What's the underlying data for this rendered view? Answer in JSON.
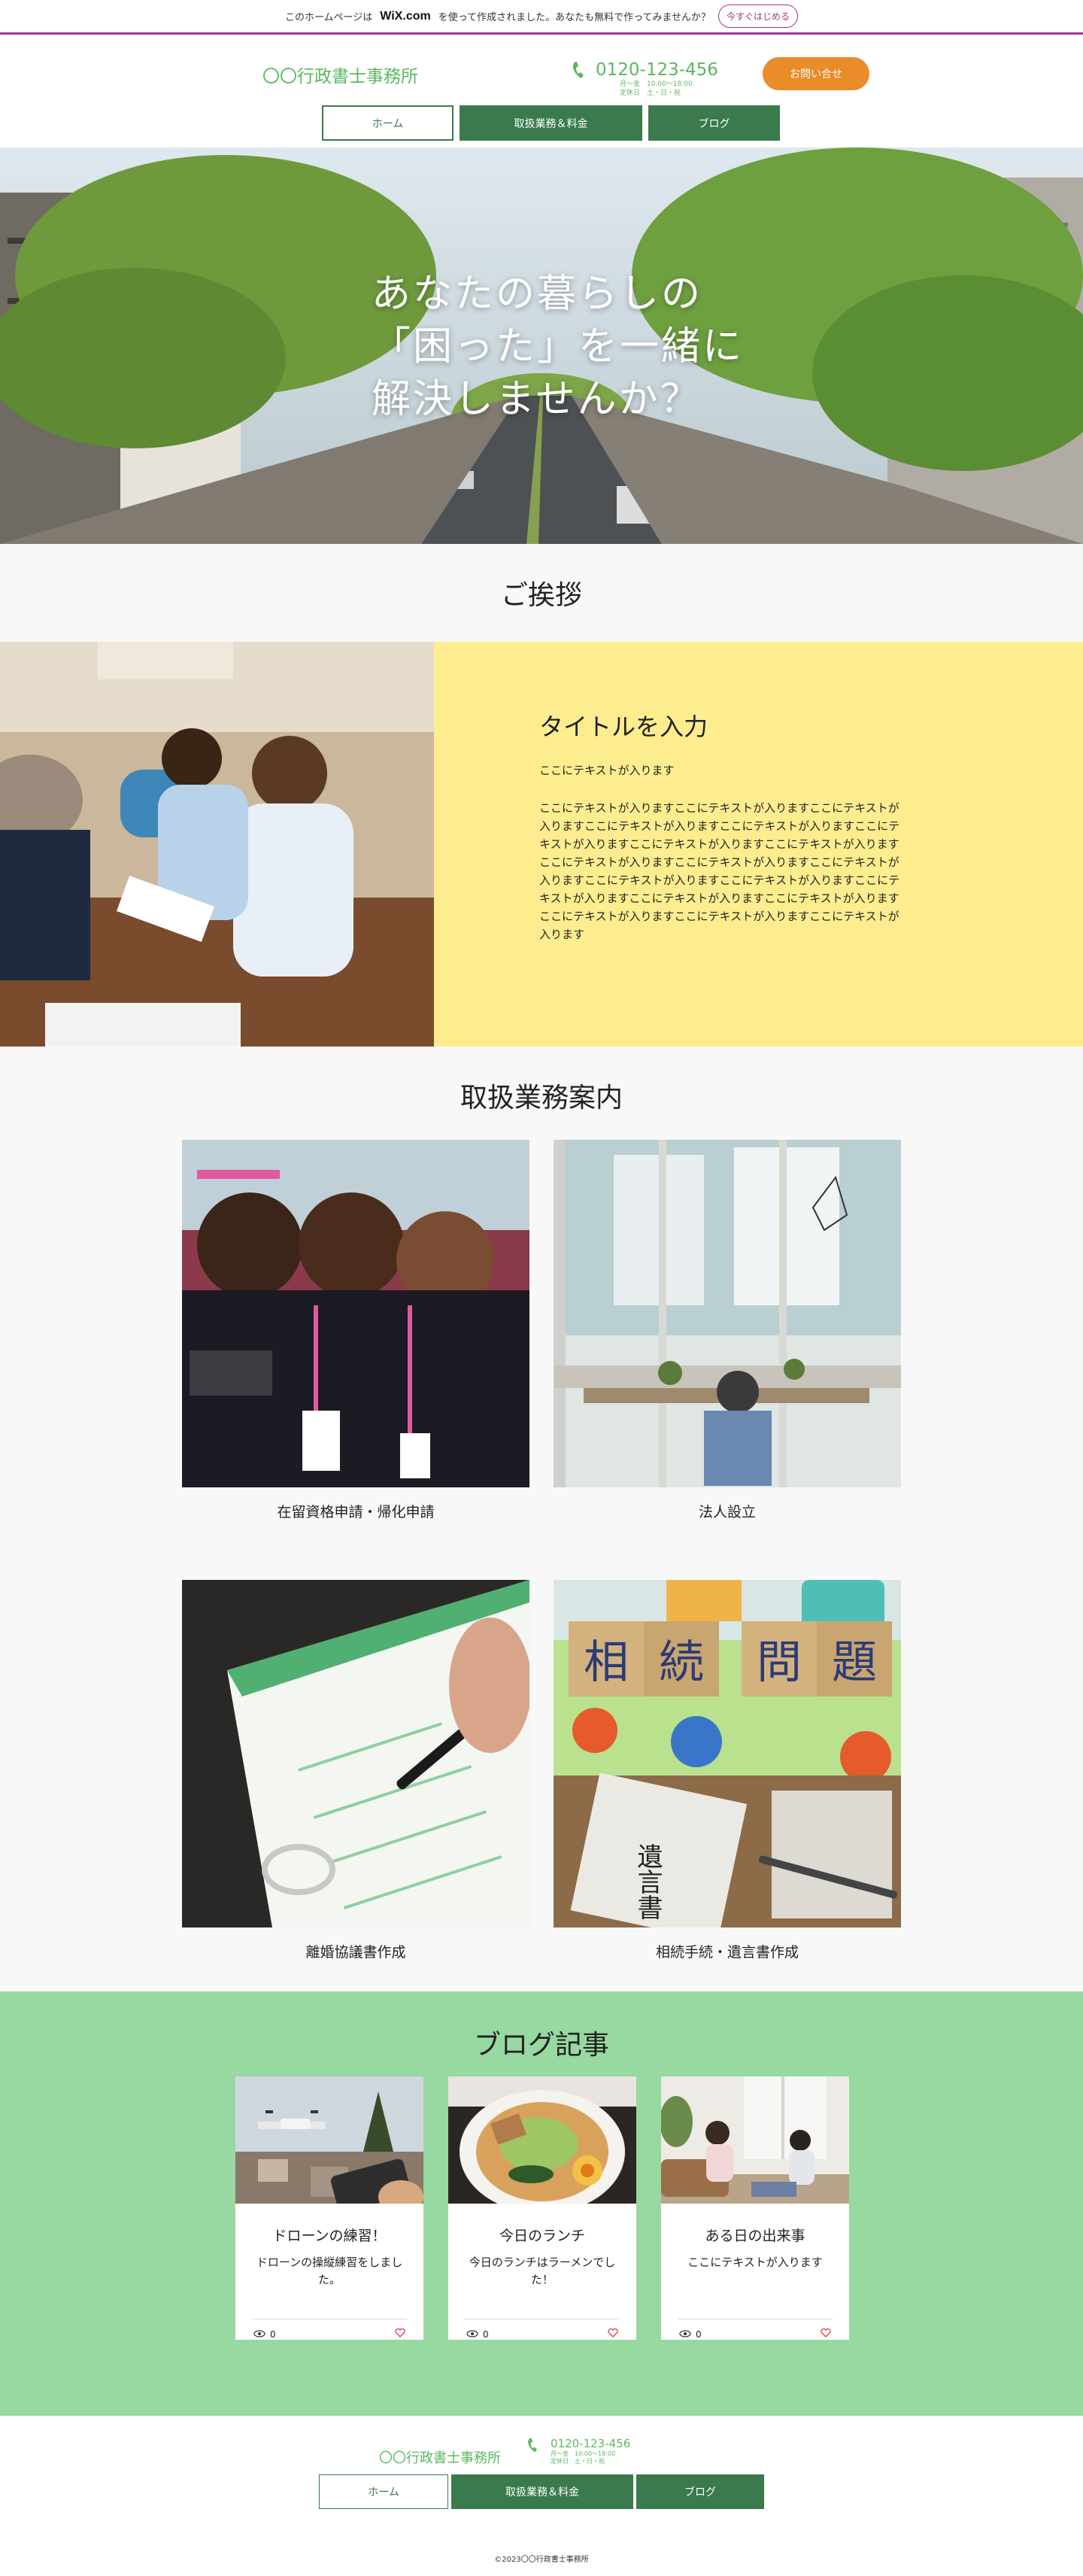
{
  "wix_banner": {
    "text_before": "このホームページは",
    "logo": "WiX.com",
    "text_after": "を使って作成されました。あなたも無料で作ってみませんか？",
    "button": "今すぐはじめる"
  },
  "header": {
    "brand": "〇〇行政書士事務所",
    "phone": "0120-123-456",
    "hours_line1": "月〜金　10:00〜18:00",
    "hours_line2": "定休日　土・日・祝",
    "contact_button": "お問い合せ",
    "nav": [
      "ホーム",
      "取扱業務＆料金",
      "ブログ"
    ]
  },
  "hero": {
    "line1": "あなたの暮らしの",
    "line2": "「困った」を一緒に",
    "line3": "解決しませんか？"
  },
  "greeting": {
    "heading": "ご挨拶",
    "title": "タイトルを入力",
    "subtitle": "ここにテキストが入ります",
    "body": "ここにテキストが入りますここにテキストが入りますここにテキストが入りますここにテキストが入りますここにテキストが入りますここにテキストが入りますここにテキストが入りますここにテキストが入りますここにテキストが入りますここにテキストが入りますここにテキストが入りますここにテキストが入りますここにテキストが入りますここにテキストが入りますここにテキストが入りますここにテキストが入りますここにテキストが入りますここにテキストが入りますここにテキストが入ります"
  },
  "services": {
    "heading": "取扱業務案内",
    "items": [
      {
        "label": "在留資格申請・帰化申請"
      },
      {
        "label": "法人設立"
      },
      {
        "label": "離婚協議書作成"
      },
      {
        "label": "相続手続・遺言書作成"
      }
    ],
    "block_text": [
      "相",
      "続",
      "問",
      "題"
    ],
    "will_text": "遺言書"
  },
  "blog": {
    "heading": "ブログ記事",
    "posts": [
      {
        "title": "ドローンの練習！",
        "excerpt": "ドローンの操縦練習をしました。",
        "views": "0"
      },
      {
        "title": "今日のランチ",
        "excerpt": "今日のランチはラーメンでした！",
        "views": "0"
      },
      {
        "title": "ある日の出来事",
        "excerpt": "ここにテキストが入ります",
        "views": "0"
      }
    ]
  },
  "footer": {
    "brand": "〇〇行政書士事務所",
    "phone": "0120-123-456",
    "hours_line1": "月〜金　10:00〜18:00",
    "hours_line2": "定休日　土・日・祝",
    "nav": [
      "ホーム",
      "取扱業務＆料金",
      "ブログ"
    ],
    "copyright": "©2023〇〇行政書士事務所"
  },
  "colors": {
    "brand_green": "#5bb760",
    "nav_green": "#3a7a4c",
    "accent_orange": "#e98c2a",
    "greeting_yellow": "#fded8f",
    "blog_green": "#98d8a1",
    "wix_purple": "#a3348f"
  }
}
